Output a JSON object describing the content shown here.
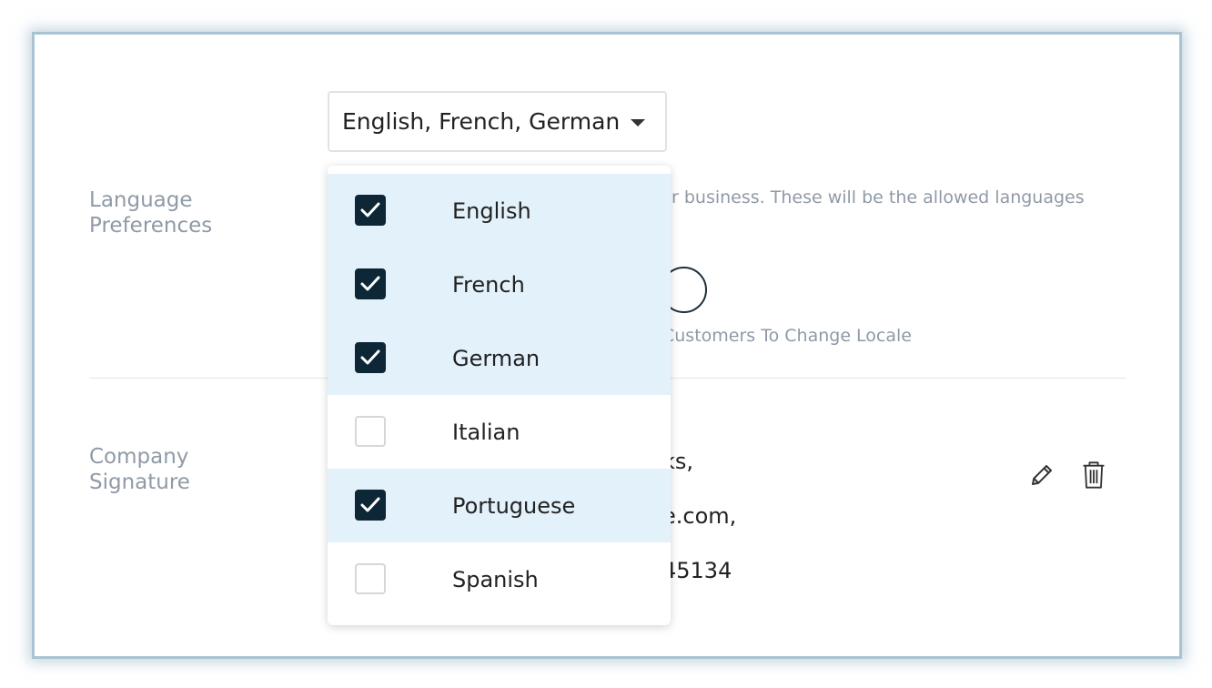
{
  "language_preferences": {
    "label": "Language Preferences",
    "select": {
      "value": "English, French, German"
    },
    "description_fragment": "r business. These will be the allowed languages",
    "toggle_label_fragment": "Customers To Change Locale",
    "options": [
      {
        "label": "English",
        "checked": true
      },
      {
        "label": "French",
        "checked": true
      },
      {
        "label": "German",
        "checked": true
      },
      {
        "label": "Italian",
        "checked": false
      },
      {
        "label": "Portuguese",
        "checked": true
      },
      {
        "label": "Spanish",
        "checked": false
      }
    ]
  },
  "company_signature": {
    "label": "Company Signature",
    "lines": [
      "ks,",
      "e.com,",
      "45134"
    ],
    "edit_icon": "pencil-icon",
    "delete_icon": "trash-icon"
  },
  "colors": {
    "checked_row_bg": "#e3f1fa",
    "checkbox_fill": "#0d2736",
    "label_gray": "#8f9aa6",
    "frame_border": "#a9c3d3"
  }
}
